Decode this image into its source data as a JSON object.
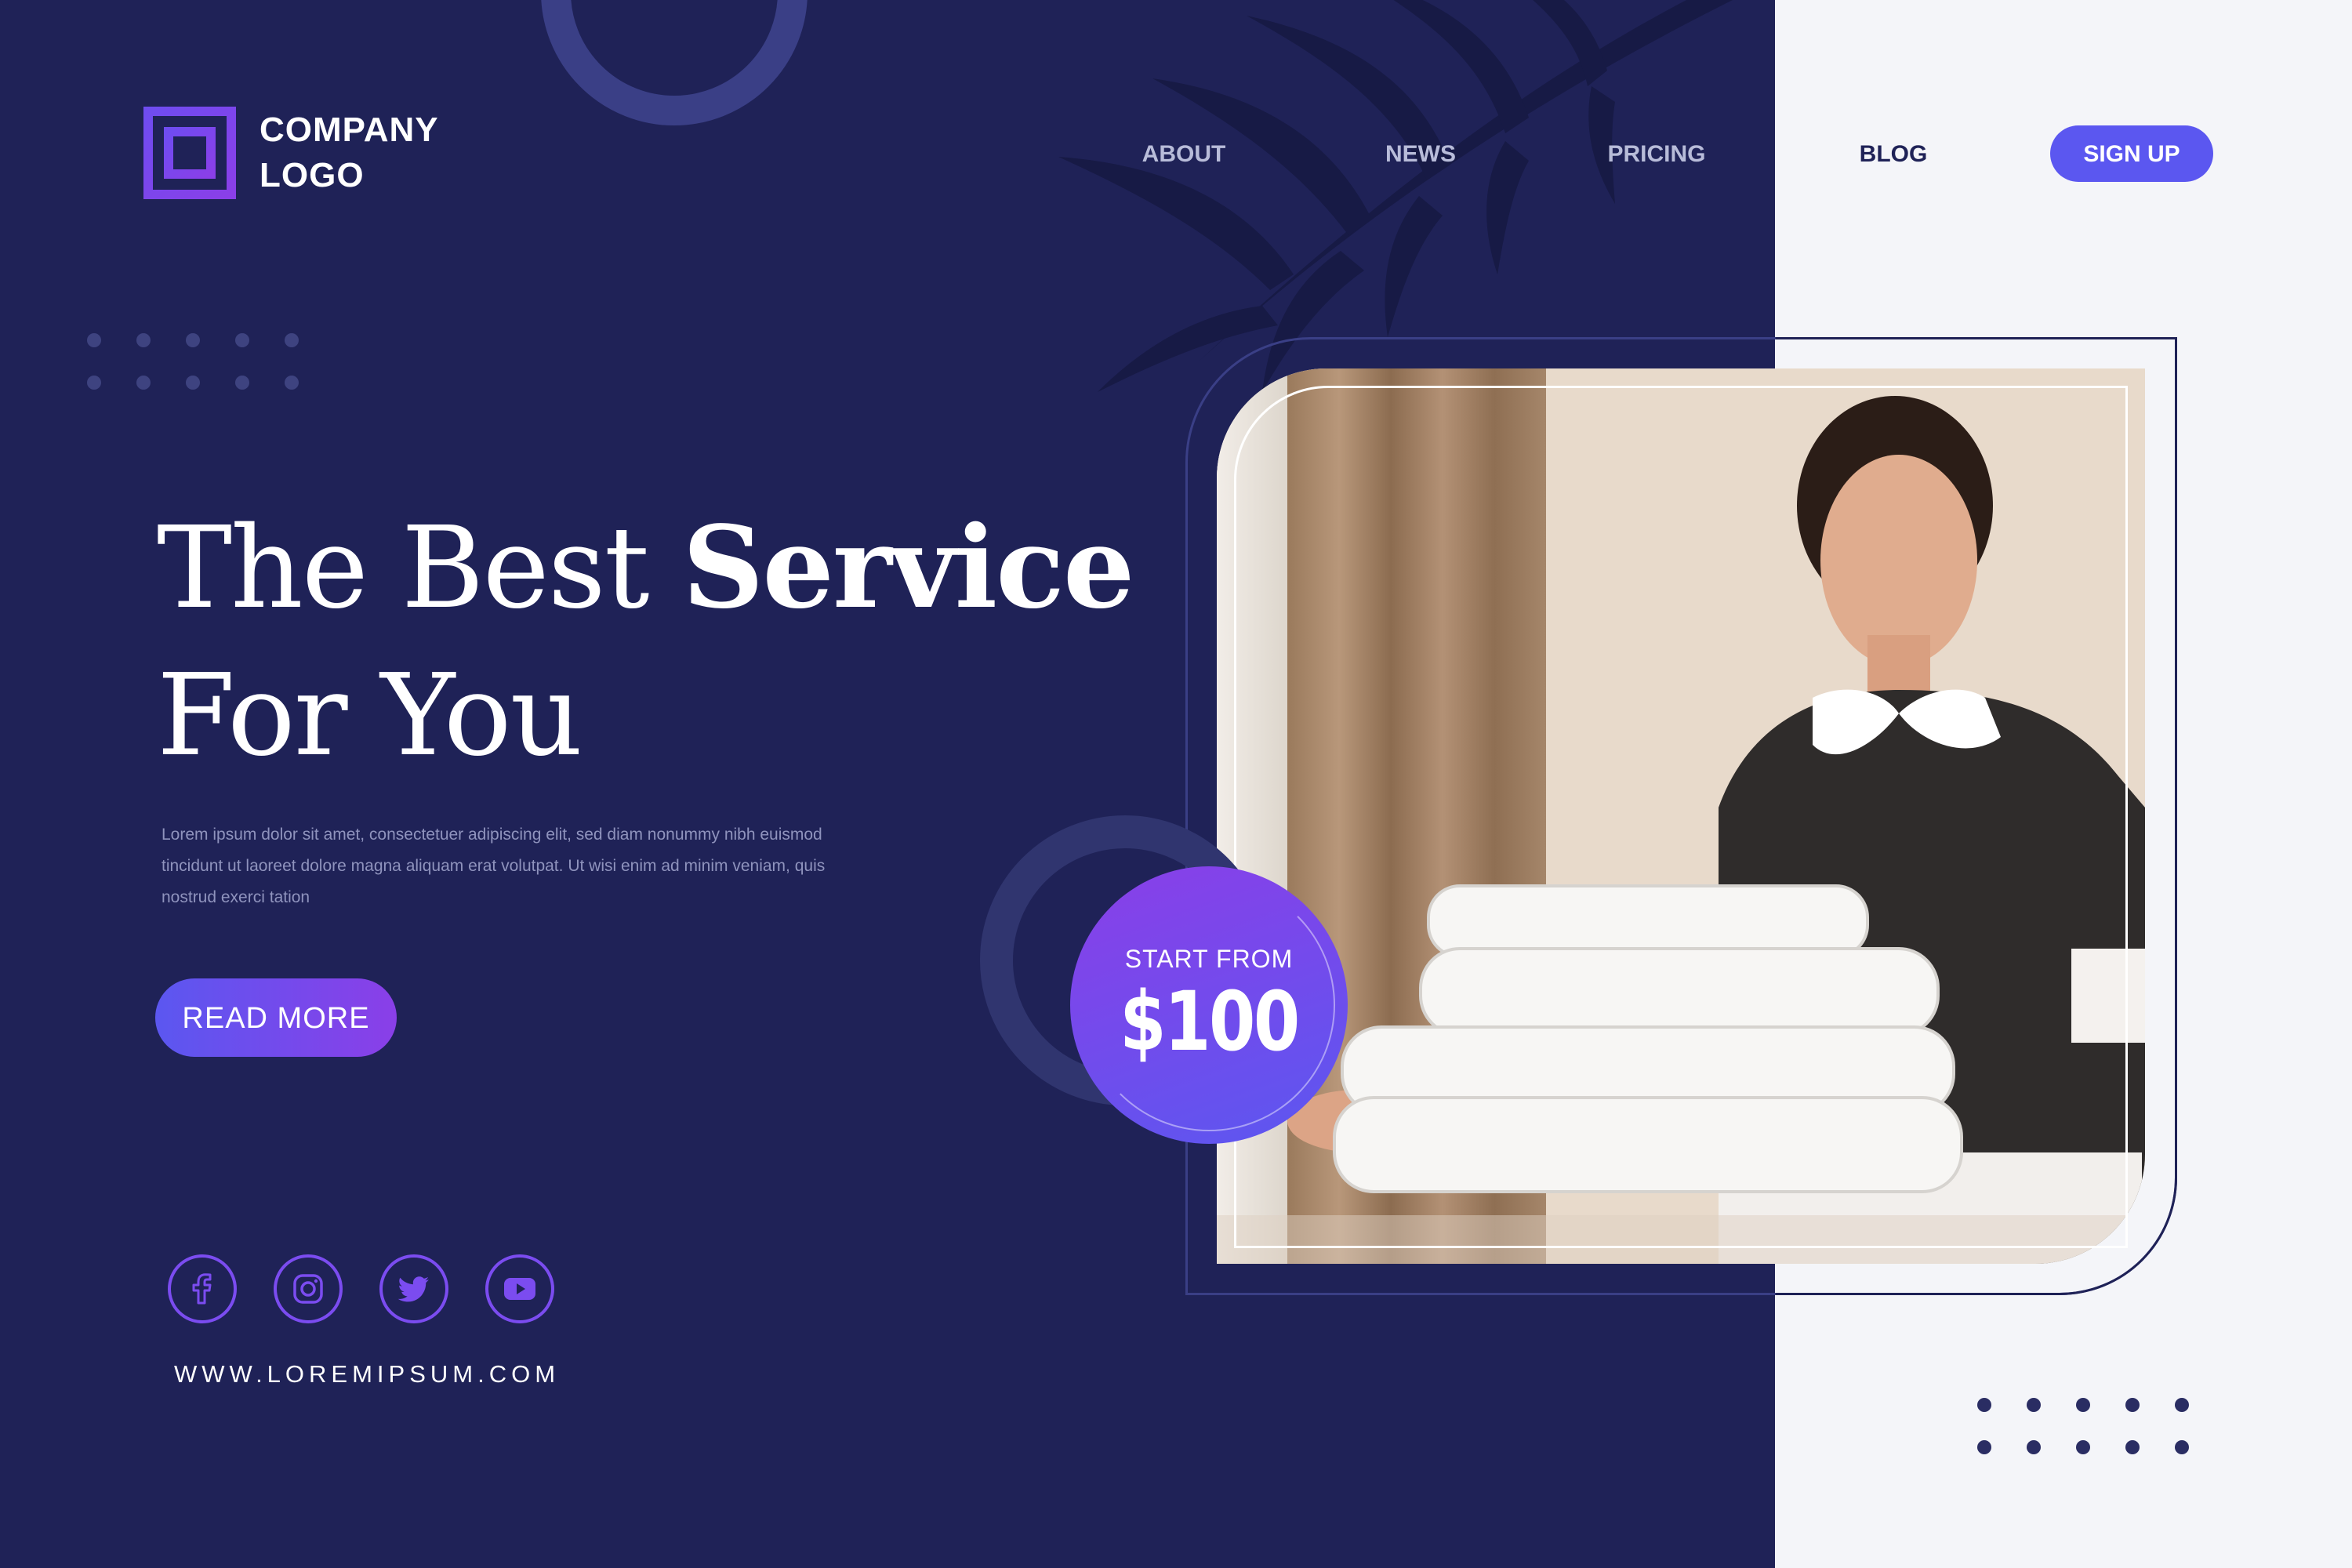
{
  "brand": {
    "logo_line1": "COMPANY",
    "logo_line2": "LOGO",
    "accent_color": "#5b57f0",
    "purple_color": "#8a3fe8",
    "navy_color": "#1f2257"
  },
  "nav": {
    "items": [
      {
        "label": "ABOUT"
      },
      {
        "label": "NEWS"
      },
      {
        "label": "PRICING"
      },
      {
        "label": "BLOG"
      }
    ],
    "signup_label": "SIGN UP"
  },
  "hero": {
    "title_regular": "The Best ",
    "title_bold": "Service",
    "title_line2": "For You",
    "description": "Lorem ipsum dolor sit amet, consectetuer adipiscing elit, sed diam nonummy nibh euismod tincidunt ut laoreet dolore magna aliquam erat volutpat. Ut wisi enim ad minim veniam, quis nostrud exerci tation",
    "read_more_label": "READ MORE"
  },
  "price": {
    "label": "START FROM",
    "value": "$100"
  },
  "social": {
    "icons": [
      "facebook-icon",
      "instagram-icon",
      "twitter-icon",
      "youtube-icon"
    ],
    "website": "WWW.LOREMIPSUM.COM"
  },
  "photo": {
    "subject": "housekeeper-holding-towels-photo"
  }
}
